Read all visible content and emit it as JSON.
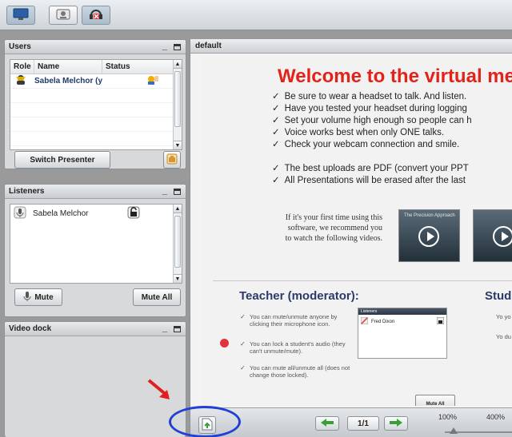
{
  "toolbar": {
    "buttons": [
      {
        "icon": "monitor-icon"
      },
      {
        "icon": "webcam-icon"
      },
      {
        "icon": "audio-off-icon"
      }
    ]
  },
  "users_panel": {
    "title": "Users",
    "columns": [
      "Role",
      "Name",
      "Status"
    ],
    "rows": [
      {
        "role_icon": "presenter-icon",
        "name": "Sabela Melchor (y",
        "status_icon": "raise-hand-icon"
      }
    ],
    "switch_presenter_label": "Switch Presenter"
  },
  "listeners_panel": {
    "title": "Listeners",
    "items": [
      {
        "name": "Sabela Melchor"
      }
    ],
    "mute_label": "Mute",
    "mute_all_label": "Mute All"
  },
  "video_dock": {
    "title": "Video dock"
  },
  "presentation": {
    "title": "default",
    "slide": {
      "heading": "Welcome to the virtual me",
      "bullets_top": [
        "Be sure to wear a headset to talk. And listen.",
        "Have you tested your headset during logging",
        "Set your volume high enough so people can h",
        "Voice works best when only ONE talks.",
        "Check your webcam connection and smile."
      ],
      "bullets_bottom": [
        "The best uploads are PDF (convert your PPT",
        "All Presentations will be erased after the last"
      ],
      "video_intro": "If it's your first time using this software, we recommend you to watch the following videos.",
      "video_caption": "The Precision Approach",
      "teacher_heading": "Teacher (moderator):",
      "student_heading": "Stud",
      "teacher_items": [
        "You can mute/unmute anyone by clicking their microphone icon.",
        "You can lock a student's audio (they can't unmute/mute).",
        "You can mute all/unmute all (does not change those locked)."
      ],
      "student_items": [
        "Yo yo",
        "Yo du mi"
      ],
      "mini_panel_title": "Listeners",
      "mini_panel_user": "Fred Dixon",
      "mini_mute_all": "Mute All"
    },
    "footer": {
      "page": "1/1",
      "zoom_min": "100%",
      "zoom_max": "400%",
      "zoom_level": 0
    }
  },
  "colors": {
    "slide_heading": "#e32219",
    "annotation_ellipse": "#1e40d6",
    "annotation_arrow": "#e02020"
  }
}
